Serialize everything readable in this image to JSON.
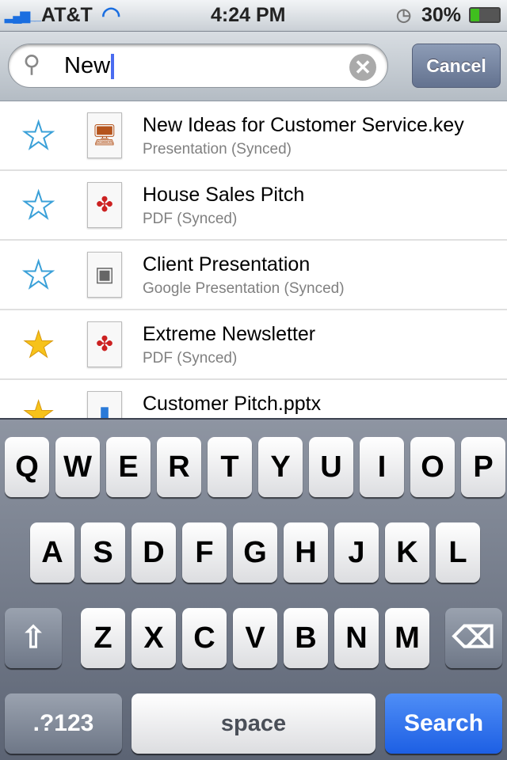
{
  "status": {
    "carrier": "AT&T",
    "time": "4:24 PM",
    "battery": "30%",
    "battery_level": 0.3
  },
  "search": {
    "query": "New",
    "cancel_label": "Cancel"
  },
  "results": [
    {
      "title": "New Ideas for Customer Service.key",
      "subtitle": "Presentation (Synced)",
      "starred": false,
      "icon": "keynote-icon"
    },
    {
      "title": "House Sales Pitch",
      "subtitle": "PDF (Synced)",
      "starred": false,
      "icon": "pdf-icon"
    },
    {
      "title": "Client Presentation",
      "subtitle": "Google Presentation (Synced)",
      "starred": false,
      "icon": "google-presentation-icon"
    },
    {
      "title": "Extreme Newsletter",
      "subtitle": "PDF (Synced)",
      "starred": true,
      "icon": "pdf-icon"
    },
    {
      "title": "Customer Pitch.pptx",
      "subtitle": "",
      "starred": true,
      "icon": "powerpoint-icon"
    }
  ],
  "keyboard": {
    "row1": [
      "Q",
      "W",
      "E",
      "R",
      "T",
      "Y",
      "U",
      "I",
      "O",
      "P"
    ],
    "row2": [
      "A",
      "S",
      "D",
      "F",
      "G",
      "H",
      "J",
      "K",
      "L"
    ],
    "row3": [
      "Z",
      "X",
      "C",
      "V",
      "B",
      "N",
      "M"
    ],
    "numbers_label": ".?123",
    "space_label": "space",
    "search_label": "Search"
  }
}
